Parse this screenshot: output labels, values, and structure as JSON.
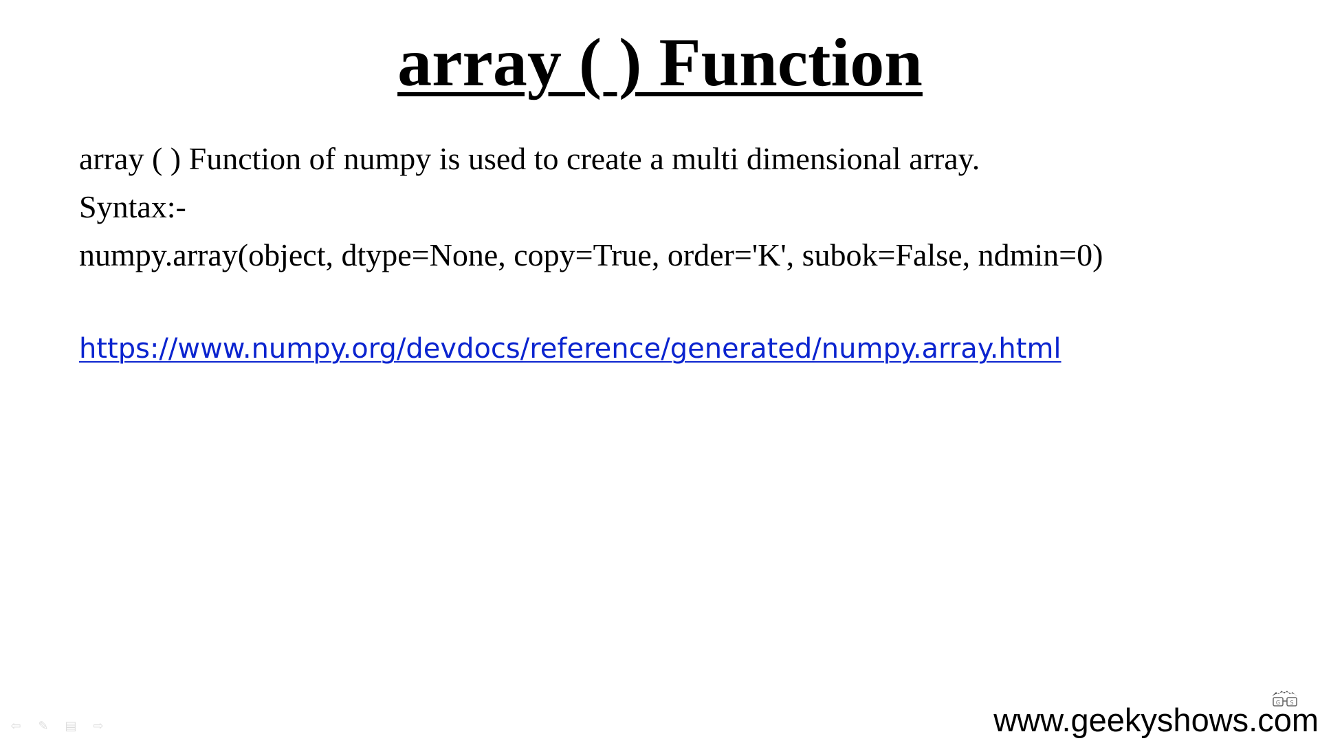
{
  "slide": {
    "title": "array ( ) Function",
    "lines": [
      "array ( ) Function of numpy is used to create a multi dimensional array.",
      "Syntax:-",
      "numpy.array(object, dtype=None, copy=True, order='K', subok=False, ndmin=0)"
    ],
    "link": "https://www.numpy.org/devdocs/reference/generated/numpy.array.html"
  },
  "watermark": {
    "text": "www.geekyshows.com",
    "logo_text": "G S"
  },
  "controls": {
    "icons": [
      "previous-arrow-icon",
      "pen-icon",
      "menu-icon",
      "next-arrow-icon"
    ]
  },
  "colors": {
    "link": "#0b24cf",
    "text": "#000000",
    "background": "#ffffff"
  }
}
